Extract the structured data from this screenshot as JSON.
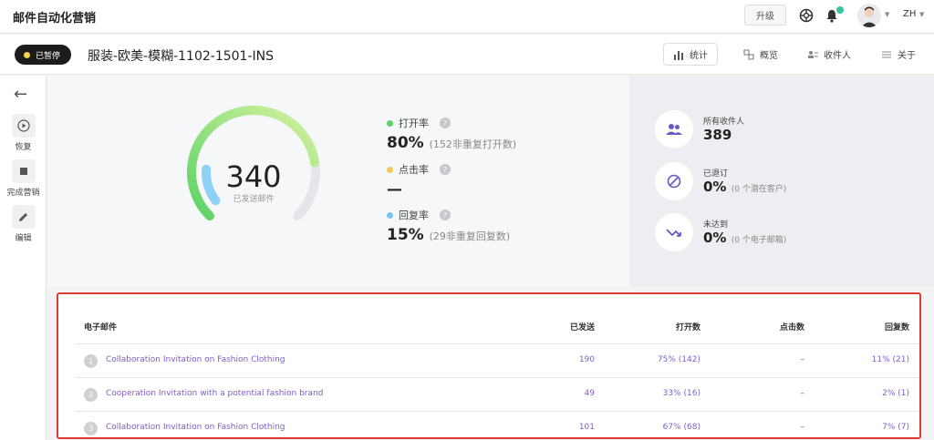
{
  "app": {
    "title": "邮件自动化营销"
  },
  "topbar": {
    "upgrade_label": "升级",
    "lang": "ZH"
  },
  "subheader": {
    "status": "已暂停",
    "campaign_name": "服装-欧美-模糊-1102-1501-INS",
    "tabs": [
      {
        "label": "统计",
        "icon": "bar-chart-icon",
        "active": true
      },
      {
        "label": "概览",
        "icon": "overview-icon",
        "active": false
      },
      {
        "label": "收件人",
        "icon": "recipients-icon",
        "active": false
      },
      {
        "label": "关于",
        "icon": "list-icon",
        "active": false
      }
    ]
  },
  "leftrail": {
    "items": [
      {
        "label": "恢复",
        "icon": "play-icon"
      },
      {
        "label": "完成营销",
        "icon": "stop-icon"
      },
      {
        "label": "编辑",
        "icon": "pencil-icon"
      }
    ]
  },
  "gauge": {
    "value": "340",
    "label": "已发送邮件",
    "open_fraction": 0.8,
    "reply_fraction": 0.15
  },
  "metrics": [
    {
      "label": "打开率",
      "value": "80%",
      "sub": "(152非重复打开数)",
      "color": "#5fd068"
    },
    {
      "label": "点击率",
      "value": "—",
      "sub": "",
      "color": "#f5c75a"
    },
    {
      "label": "回复率",
      "value": "15%",
      "sub": "(29非重复回复数)",
      "color": "#7cc4f0"
    }
  ],
  "side": [
    {
      "label": "所有收件人",
      "value": "389",
      "sub": "",
      "icon": "people-icon"
    },
    {
      "label": "已退订",
      "value": "0%",
      "sub": "(0 个潜在客户)",
      "icon": "unsubscribe-icon"
    },
    {
      "label": "未达到",
      "value": "0%",
      "sub": "(0 个电子邮箱)",
      "icon": "bounce-icon"
    }
  ],
  "table": {
    "headers": {
      "subject": "电子邮件",
      "sent": "已发送",
      "opens": "打开数",
      "clicks": "点击数",
      "replies": "回复数"
    },
    "rows": [
      {
        "num": "1",
        "subject": "Collaboration Invitation on Fashion Clothing",
        "sent": "190",
        "opens": "75% (142)",
        "clicks": "–",
        "replies": "11% (21)"
      },
      {
        "num": "2",
        "subject": "Cooperation Invitation with a potential fashion brand",
        "sent": "49",
        "opens": "33% (16)",
        "clicks": "–",
        "replies": "2% (1)"
      },
      {
        "num": "3",
        "subject": "Collaboration Invitation on Fashion Clothing",
        "sent": "101",
        "opens": "67% (68)",
        "clicks": "–",
        "replies": "7% (7)"
      }
    ]
  }
}
